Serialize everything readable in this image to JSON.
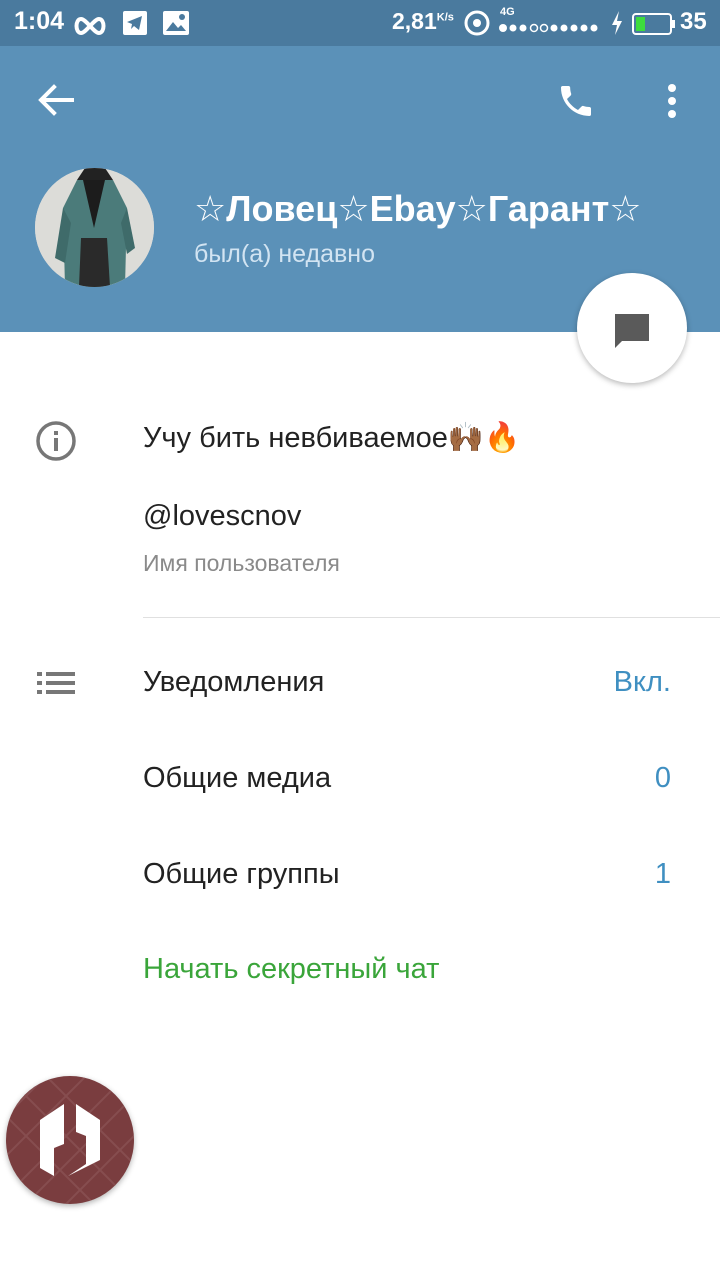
{
  "status_bar": {
    "time": "1:04",
    "speed": "2,81",
    "speed_unit": "K/s",
    "network": "4G",
    "battery": "35"
  },
  "header": {
    "name": "☆Ловец☆Ebay☆Гарант☆",
    "last_seen": "был(а) недавно",
    "bg_color": "#5b91b8"
  },
  "info": {
    "bio": "Учу бить невбиваемое🙌🏾🔥",
    "username": "@lovescnov",
    "username_label": "Имя пользователя"
  },
  "settings": {
    "notifications_label": "Уведомления",
    "notifications_value": "Вкл.",
    "media_label": "Общие медиа",
    "media_value": "0",
    "groups_label": "Общие группы",
    "groups_value": "1",
    "secret_chat_label": "Начать секретный чат"
  },
  "colors": {
    "accent_blue": "#3f8fc1",
    "secret_green": "#3aa53a"
  }
}
